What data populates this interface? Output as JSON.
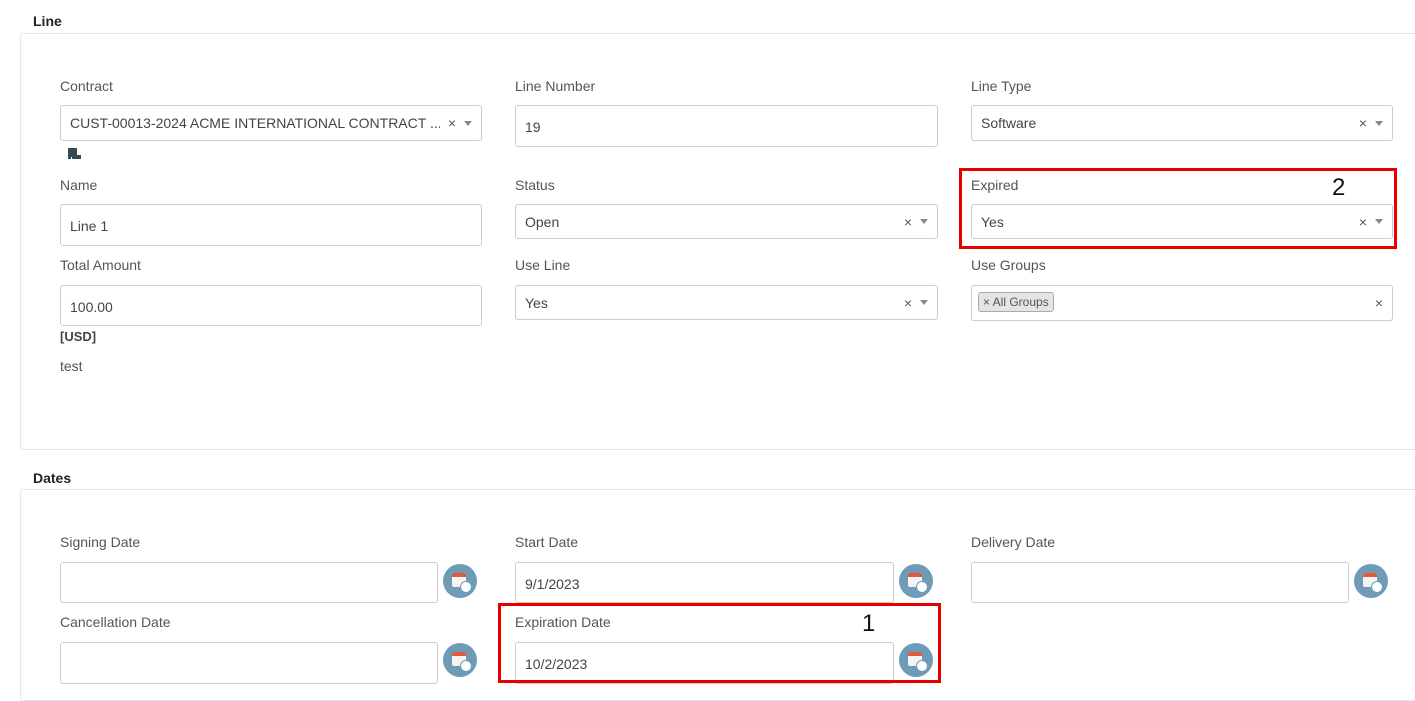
{
  "line_section": {
    "title": "Line",
    "contract": {
      "label": "Contract",
      "value": "CUST-00013-2024 ACME INTERNATIONAL CONTRACT ...",
      "icon": "scroll-icon"
    },
    "line_number": {
      "label": "Line Number",
      "value": "19"
    },
    "line_type": {
      "label": "Line Type",
      "value": "Software"
    },
    "name": {
      "label": "Name",
      "value": "Line 1"
    },
    "status": {
      "label": "Status",
      "value": "Open"
    },
    "expired": {
      "label": "Expired",
      "value": "Yes"
    },
    "total_amount": {
      "label": "Total Amount",
      "value": "100.00",
      "currency": "[USD]",
      "note": "test"
    },
    "use_line": {
      "label": "Use Line",
      "value": "Yes"
    },
    "use_groups": {
      "label": "Use Groups",
      "tag": "× All Groups"
    }
  },
  "dates_section": {
    "title": "Dates",
    "signing_date": {
      "label": "Signing Date",
      "value": ""
    },
    "start_date": {
      "label": "Start Date",
      "value": "9/1/2023"
    },
    "delivery_date": {
      "label": "Delivery Date",
      "value": ""
    },
    "cancellation_date": {
      "label": "Cancellation Date",
      "value": ""
    },
    "expiration_date": {
      "label": "Expiration Date",
      "value": "10/2/2023"
    }
  },
  "annotations": {
    "marker_1": "1",
    "marker_2": "2",
    "color": "#e60000"
  },
  "glyphs": {
    "clear": "×"
  }
}
